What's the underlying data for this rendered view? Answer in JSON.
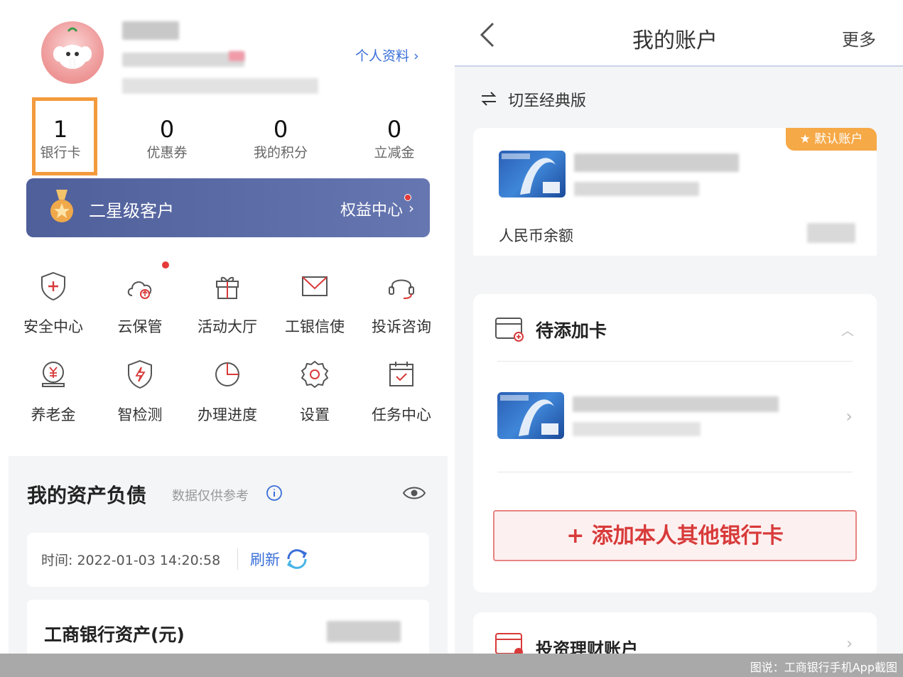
{
  "profile": {
    "link_label": "个人资料 ›"
  },
  "stats": [
    {
      "value": "1",
      "label": "银行卡"
    },
    {
      "value": "0",
      "label": "优惠券"
    },
    {
      "value": "0",
      "label": "我的积分"
    },
    {
      "value": "0",
      "label": "立减金"
    }
  ],
  "tier": {
    "name": "二星级客户",
    "rights_label": "权益中心",
    "chevron": "›"
  },
  "grid": [
    {
      "label": "安全中心",
      "icon": "shield-plus-icon"
    },
    {
      "label": "云保管",
      "icon": "cloud-icon"
    },
    {
      "label": "活动大厅",
      "icon": "gift-icon"
    },
    {
      "label": "工银信使",
      "icon": "mail-icon"
    },
    {
      "label": "投诉咨询",
      "icon": "headset-icon"
    },
    {
      "label": "养老金",
      "icon": "pension-icon"
    },
    {
      "label": "智检测",
      "icon": "shield-bolt-icon"
    },
    {
      "label": "办理进度",
      "icon": "pie-progress-icon"
    },
    {
      "label": "设置",
      "icon": "gear-icon"
    },
    {
      "label": "任务中心",
      "icon": "calendar-check-icon"
    }
  ],
  "assets": {
    "title": "我的资产负债",
    "note": "数据仅供参考",
    "time_label": "时间: 2022-01-03 14:20:58",
    "refresh_label": "刷新",
    "bank_assets_label": "工商银行资产(元)"
  },
  "account": {
    "nav_title": "我的账户",
    "more_label": "更多",
    "switch_label": "切至经典版",
    "default_badge": "★ 默认账户",
    "balance_label": "人民币余额",
    "pending_title": "待添加卡",
    "add_button": "+ 添加本人其他银行卡",
    "invest_title": "投资理财账户"
  },
  "caption": "图说：工商银行手机App截图",
  "colors": {
    "accent_blue": "#3a6fd8",
    "highlight_orange": "#f39a3d",
    "alert_red": "#d83a3a",
    "tier_bg": "#5a6aa5"
  }
}
